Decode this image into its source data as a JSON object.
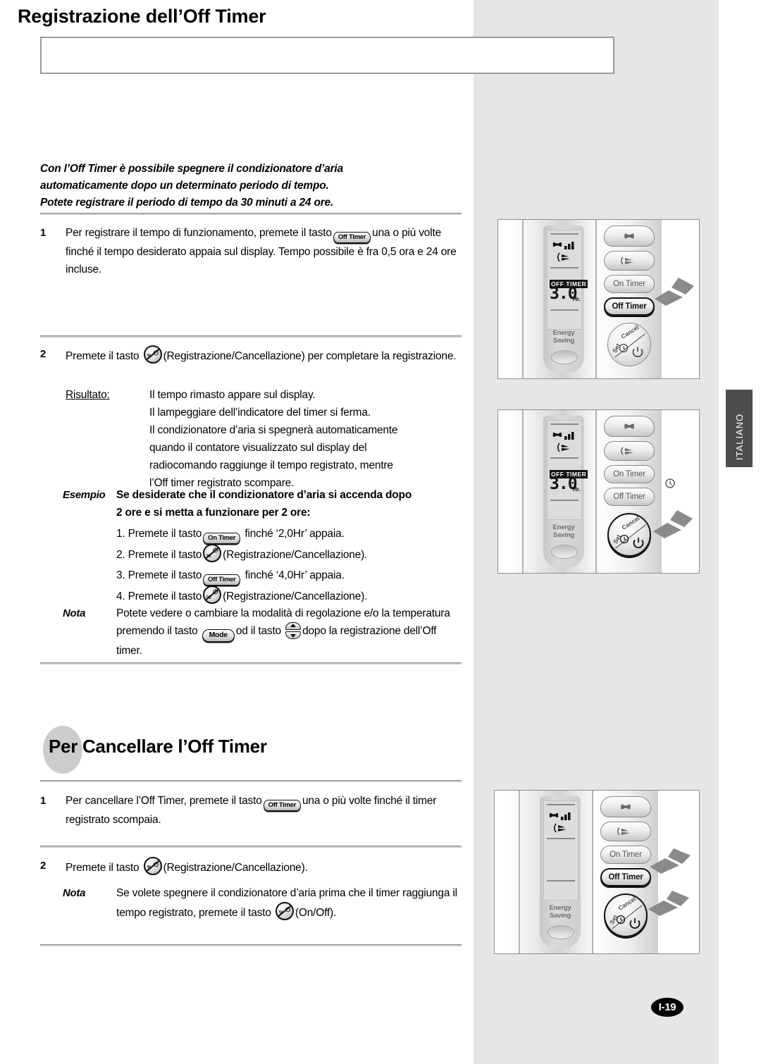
{
  "page": {
    "title": "Registrazione dell’Off Timer",
    "language_tab": "ITALIANO",
    "page_number": "I-19"
  },
  "intro": {
    "line1": "Con l’Off Timer è possibile spegnere il condizionatore d’aria",
    "line2": "automaticamente dopo un determinato periodo di tempo.",
    "line3": "Potete registrare il periodo di tempo da 30 minuti a 24 ore."
  },
  "section1": {
    "step1": {
      "number": "1",
      "text_before": "Per registrare il tempo di funzionamento, premete il tasto",
      "button": "Off Timer",
      "text_after": "una o più volte finché il tempo desiderato appaia sul display. Tempo possibile è fra 0,5 ora e 24 ore incluse."
    },
    "step2": {
      "number": "2",
      "text_before": "Premete il tasto",
      "button_icon": "set-cancel-icon",
      "text_after": "(Registrazione/Cancellazione) per completare la registrazione."
    },
    "result": {
      "label": "Risultato:",
      "lines": [
        "Il tempo rimasto appare sul display.",
        "Il lampeggiare dell’indicatore del timer si ferma.",
        "Il condizionatore d’aria si spegnerà automaticamente",
        "quando il contatore visualizzato sul display del",
        "radiocomando raggiunge il tempo registrato, mentre",
        "l’Off timer registrato scompare."
      ]
    },
    "esempio": {
      "tag": "Esempio",
      "head_line1": "Se desiderate che il condizionatore d’aria si accenda dopo",
      "head_line2": "2 ore e si metta a funzionare per 2 ore:",
      "items": [
        {
          "n": "1.",
          "before": "Premete il tasto",
          "button": "On Timer",
          "after": "finché ‘2,0Hr’ appaia."
        },
        {
          "n": "2.",
          "before": "Premete il tasto",
          "button_icon": "set-cancel-icon",
          "after": "(Registrazione/Cancellazione)."
        },
        {
          "n": "3.",
          "before": "Premete il tasto",
          "button": "Off Timer",
          "after": "finché ‘4,0Hr’ appaia."
        },
        {
          "n": "4.",
          "before": "Premete il tasto",
          "button_icon": "set-cancel-icon",
          "after": "(Registrazione/Cancellazione)."
        }
      ]
    },
    "nota": {
      "tag": "Nota",
      "before": "Potete vedere o cambiare la modalità di regolazione e/o la temperatura premendo il tasto",
      "button_mode": "Mode",
      "middle": "od il tasto",
      "button_updown": "up-down-icon",
      "after": "dopo la registrazione dell’Off timer."
    }
  },
  "section2": {
    "heading": "Per Cancellare l’Off Timer",
    "step1": {
      "number": "1",
      "text_before": "Per cancellare l’Off Timer, premete il tasto",
      "button": "Off Timer",
      "text_after": "una o più volte finché il timer registrato scompaia."
    },
    "step2": {
      "number": "2",
      "text_before": "Premete il tasto",
      "button_icon": "set-cancel-icon",
      "text_after": "(Registrazione/Cancellazione)."
    },
    "nota": {
      "tag": "Nota",
      "before": "Se volete spegnere il condizionatore d’aria prima che il timer raggiunga il tempo registrato, premete il tasto",
      "button_icon": "set-cancel-icon",
      "after": "(On/Off)."
    }
  },
  "figures": [
    {
      "id": "figure-1",
      "lcd": {
        "timer_label": "OFF TIMER",
        "digits": "3.0",
        "unit": "Hr.",
        "show_timer": true
      },
      "energy_label": "Energy Saving",
      "buttons": {
        "fan": "fan-icon",
        "swing": "swing-icon",
        "on_timer": "On Timer",
        "off_timer": "Off Timer",
        "set_cancel_set": "Set",
        "set_cancel_cancel": "Cancel"
      },
      "highlight": [
        "off-timer-button"
      ],
      "arrows": [
        "arrow-to-off-timer"
      ]
    },
    {
      "id": "figure-2",
      "lcd": {
        "timer_label": "OFF TIMER",
        "digits": "3.0",
        "unit": "Hr.",
        "show_timer": true
      },
      "energy_label": "Energy Saving",
      "buttons": {
        "fan": "fan-icon",
        "swing": "swing-icon",
        "on_timer": "On Timer",
        "off_timer": "Off Timer",
        "set_cancel_set": "Set",
        "set_cancel_cancel": "Cancel"
      },
      "highlight": [
        "set-cancel-button"
      ],
      "arrows": [
        "arrow-to-set-cancel"
      ]
    },
    {
      "id": "figure-3",
      "lcd": {
        "timer_label": "",
        "digits": "",
        "unit": "",
        "show_timer": false
      },
      "energy_label": "Energy Saving",
      "buttons": {
        "fan": "fan-icon",
        "swing": "swing-icon",
        "on_timer": "On Timer",
        "off_timer": "Off Timer",
        "set_cancel_set": "Set",
        "set_cancel_cancel": "Cancel"
      },
      "highlight": [
        "off-timer-button",
        "set-cancel-button"
      ],
      "arrows": [
        "arrow-to-off-timer",
        "arrow-to-set-cancel"
      ]
    }
  ],
  "colors": {
    "panel_gray": "#e6e6e6",
    "tab_gray": "#4d4d4d",
    "rule_gray": "#8c8c8c",
    "ellipse_gray": "#cccccc"
  }
}
